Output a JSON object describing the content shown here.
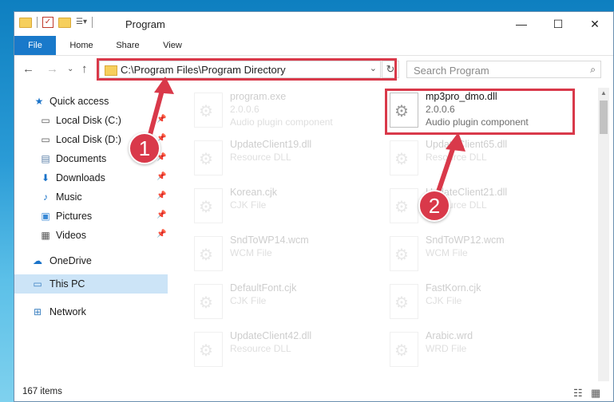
{
  "window": {
    "title": "Program",
    "minimize_icon": "—",
    "maximize_icon": "☐",
    "close_icon": "✕"
  },
  "ribbon": {
    "tabs": [
      "File",
      "Home",
      "Share",
      "View"
    ]
  },
  "address_bar": {
    "path": "C:\\Program Files\\Program Directory"
  },
  "search": {
    "placeholder": "Search Program"
  },
  "nav": {
    "items": [
      {
        "label": "Quick access",
        "icon": "star-icon"
      },
      {
        "label": "Local Disk (C:)",
        "icon": "drive-icon"
      },
      {
        "label": "Local Disk (D:)",
        "icon": "drive-icon"
      },
      {
        "label": "Documents",
        "icon": "documents-icon"
      },
      {
        "label": "Downloads",
        "icon": "downloads-icon"
      },
      {
        "label": "Music",
        "icon": "music-icon"
      },
      {
        "label": "Pictures",
        "icon": "pictures-icon"
      },
      {
        "label": "Videos",
        "icon": "videos-icon"
      },
      {
        "label": "OneDrive",
        "icon": "cloud-icon"
      },
      {
        "label": "This PC",
        "icon": "computer-icon",
        "selected": true
      },
      {
        "label": "Network",
        "icon": "network-icon"
      }
    ]
  },
  "files": [
    {
      "name": "program.exe",
      "line2": "2.0.0.6",
      "line3": "Audio plugin component"
    },
    {
      "name": "mp3pro_dmo.dll",
      "line2": "2.0.0.6",
      "line3": "Audio plugin component",
      "highlighted": true
    },
    {
      "name": "UpdateClient19.dll",
      "line2": "Resource DLL",
      "line3": ""
    },
    {
      "name": "UpdateClient65.dll",
      "line2": "Resource DLL",
      "line3": ""
    },
    {
      "name": "Korean.cjk",
      "line2": "CJK File",
      "line3": ""
    },
    {
      "name": "UpdateClient21.dll",
      "line2": "Resource DLL",
      "line3": ""
    },
    {
      "name": "SndToWP14.wcm",
      "line2": "WCM File",
      "line3": ""
    },
    {
      "name": "SndToWP12.wcm",
      "line2": "WCM File",
      "line3": ""
    },
    {
      "name": "DefaultFont.cjk",
      "line2": "CJK File",
      "line3": ""
    },
    {
      "name": "FastKorn.cjk",
      "line2": "CJK File",
      "line3": ""
    },
    {
      "name": "UpdateClient42.dll",
      "line2": "Resource DLL",
      "line3": ""
    },
    {
      "name": "Arabic.wrd",
      "line2": "WRD File",
      "line3": ""
    }
  ],
  "status": {
    "item_count": "167 items"
  },
  "annotations": {
    "badge1": "1",
    "badge2": "2",
    "color": "#d9394a"
  }
}
